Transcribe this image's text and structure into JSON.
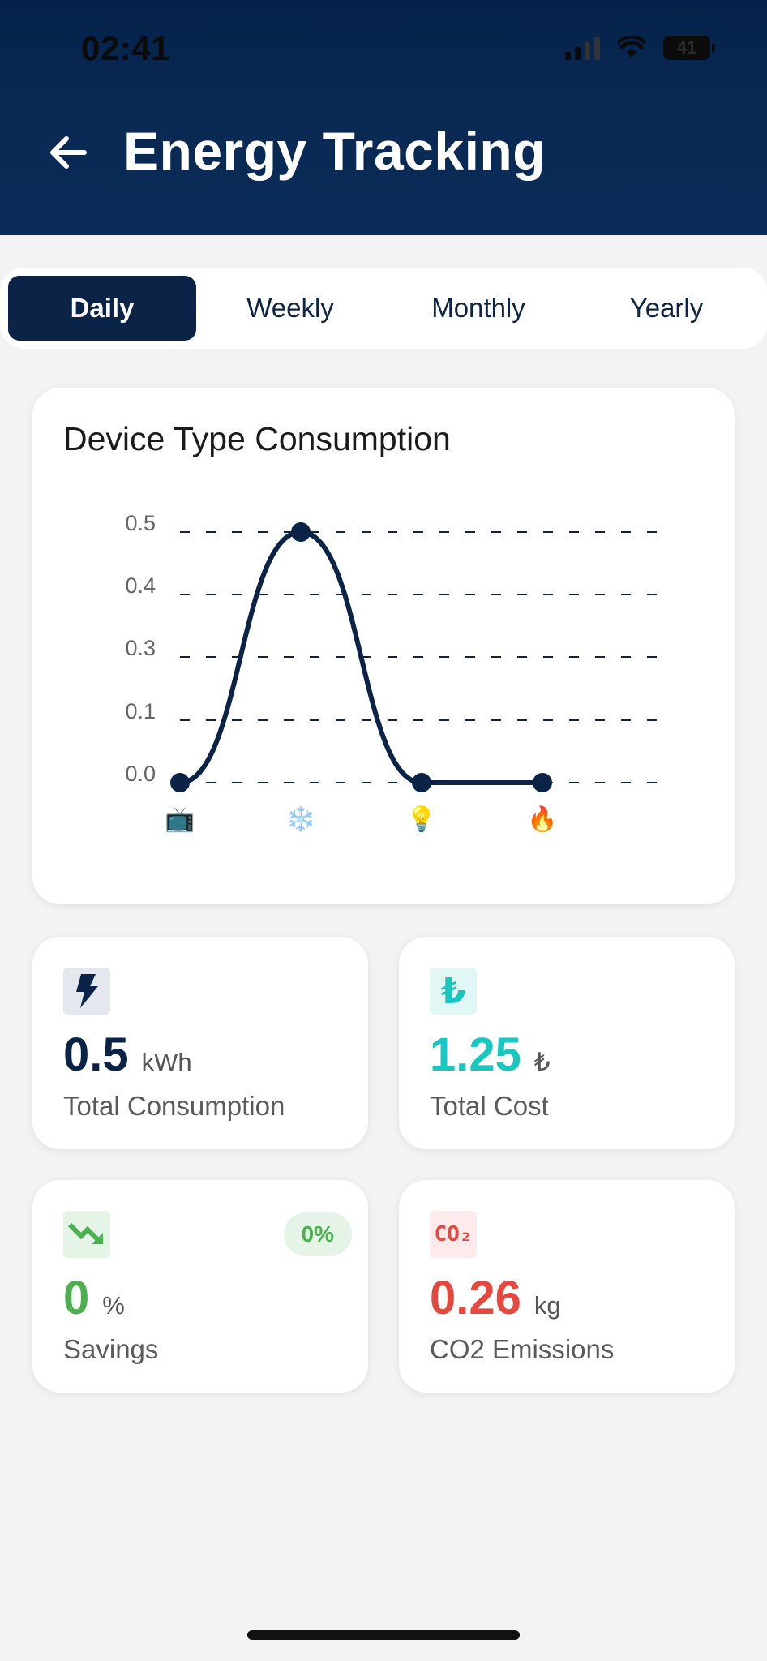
{
  "status_bar": {
    "time": "02:41",
    "battery": "41"
  },
  "header": {
    "title": "Energy Tracking"
  },
  "tabs": [
    {
      "label": "Daily",
      "active": true
    },
    {
      "label": "Weekly",
      "active": false
    },
    {
      "label": "Monthly",
      "active": false
    },
    {
      "label": "Yearly",
      "active": false
    }
  ],
  "chart_card": {
    "title": "Device Type Consumption"
  },
  "chart_data": {
    "type": "line",
    "title": "Device Type Consumption",
    "categories": [
      "📺",
      "❄️",
      "💡",
      "🔥"
    ],
    "series": [
      {
        "values": [
          0.0,
          0.5,
          0.0,
          0.0
        ]
      }
    ],
    "y_tick_labels": [
      "0.5",
      "0.4",
      "0.3",
      "0.1",
      "0.0"
    ],
    "ylim": [
      0,
      0.5
    ],
    "grid": "dashed horizontal",
    "line_color": "#0a2346"
  },
  "stats": {
    "consumption": {
      "value": "0.5",
      "unit": "kWh",
      "label": "Total Consumption",
      "icon": "lightning-icon",
      "color": "#0a2346",
      "icon_bg": "#e4e8ee"
    },
    "cost": {
      "value": "1.25",
      "unit": "₺",
      "label": "Total Cost",
      "icon": "lira-icon",
      "icon_glyph": "₺",
      "color": "#19c6c0",
      "icon_bg": "#e0f7f6"
    },
    "savings": {
      "value": "0",
      "unit": "%",
      "label": "Savings",
      "badge": "0%",
      "icon": "trending-down-icon",
      "color": "#4caf50",
      "icon_bg": "#e6f4e8"
    },
    "emissions": {
      "value": "0.26",
      "unit": "kg",
      "label": "CO2 Emissions",
      "icon": "co2-icon",
      "icon_glyph": "CO₂",
      "color": "#e5483f",
      "icon_bg": "#fdeaea"
    }
  }
}
